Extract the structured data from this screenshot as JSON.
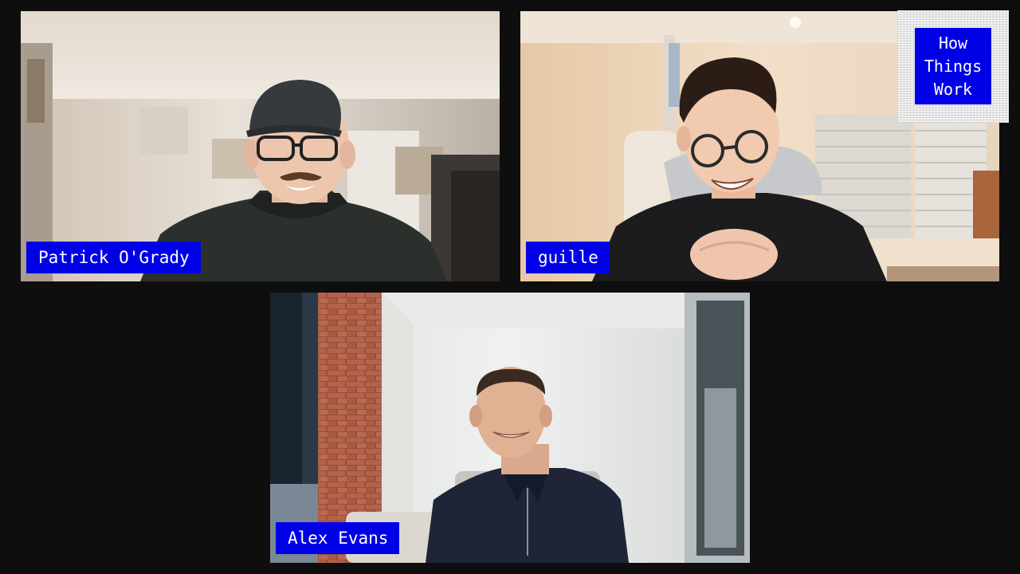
{
  "participants": [
    {
      "name": "Patrick O'Grady"
    },
    {
      "name": "guille"
    },
    {
      "name": "Alex Evans"
    }
  ],
  "logo": {
    "lines": [
      "How",
      "Things",
      "Work"
    ]
  },
  "colors": {
    "background": "#0e0e0e",
    "name_tag": "#0000e6",
    "name_tag_text": "#ffffff"
  }
}
